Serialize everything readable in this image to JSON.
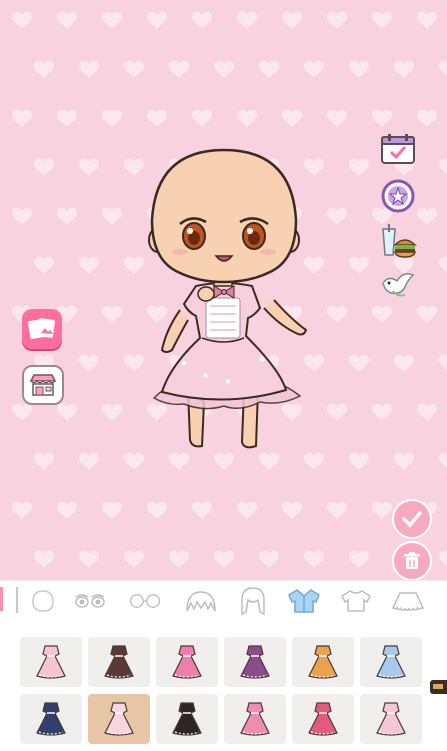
{
  "scene": {
    "background_color": "#f8d3df",
    "heart_color": "#fbe8ee"
  },
  "character": {
    "skin_color": "#f8d0b2",
    "dress_color": "#f7cfdd",
    "eye_color": "#c0561f",
    "state": "bald, wearing pink lace dress"
  },
  "left_buttons": [
    {
      "id": "photos",
      "icon": "photo-album-icon"
    },
    {
      "id": "shop",
      "icon": "shop-icon"
    }
  ],
  "right_buttons": [
    {
      "id": "calendar",
      "icon": "calendar-check-icon"
    },
    {
      "id": "badge",
      "icon": "star-badge-icon"
    },
    {
      "id": "food",
      "icon": "drink-burger-icon"
    },
    {
      "id": "dove",
      "icon": "dove-icon"
    }
  ],
  "action_buttons": [
    {
      "id": "confirm",
      "icon": "checkmark-icon"
    },
    {
      "id": "delete",
      "icon": "trash-icon"
    }
  ],
  "categories": [
    {
      "id": "face",
      "icon": "face-icon"
    },
    {
      "id": "eyes",
      "icon": "eyes-icon"
    },
    {
      "id": "glasses",
      "icon": "glasses-icon"
    },
    {
      "id": "hair",
      "icon": "hair-icon"
    },
    {
      "id": "back-hair",
      "icon": "long-hair-icon"
    },
    {
      "id": "jacket",
      "icon": "jacket-icon",
      "active": true
    },
    {
      "id": "top",
      "icon": "shirt-icon"
    },
    {
      "id": "skirt",
      "icon": "skirt-icon"
    }
  ],
  "items": [
    {
      "name": "pink-shawl",
      "color": "#f4c6cf",
      "selected": false
    },
    {
      "name": "black-bolero",
      "color": "#5a3a36",
      "selected": false
    },
    {
      "name": "pink-top",
      "color": "#ee7fa8",
      "selected": false
    },
    {
      "name": "purple-lolita-dress",
      "color": "#8a4c8a",
      "selected": false
    },
    {
      "name": "orange-gingham-dress",
      "color": "#e9a24d",
      "selected": false
    },
    {
      "name": "blue-sailor-dress",
      "color": "#a9c9ec",
      "selected": false
    },
    {
      "name": "navy-wine-dress",
      "color": "#2f3f6e",
      "selected": false
    },
    {
      "name": "pink-lace-dress",
      "color": "#f7d6df",
      "selected": true
    },
    {
      "name": "black-white-maid",
      "color": "#2c2627",
      "selected": false
    },
    {
      "name": "pink-tiered-dress",
      "color": "#f08bb1",
      "selected": false
    },
    {
      "name": "red-bow-dress",
      "color": "#e25a7c",
      "selected": false
    },
    {
      "name": "strawberry-dress",
      "color": "#f5c7d4",
      "selected": false
    }
  ]
}
